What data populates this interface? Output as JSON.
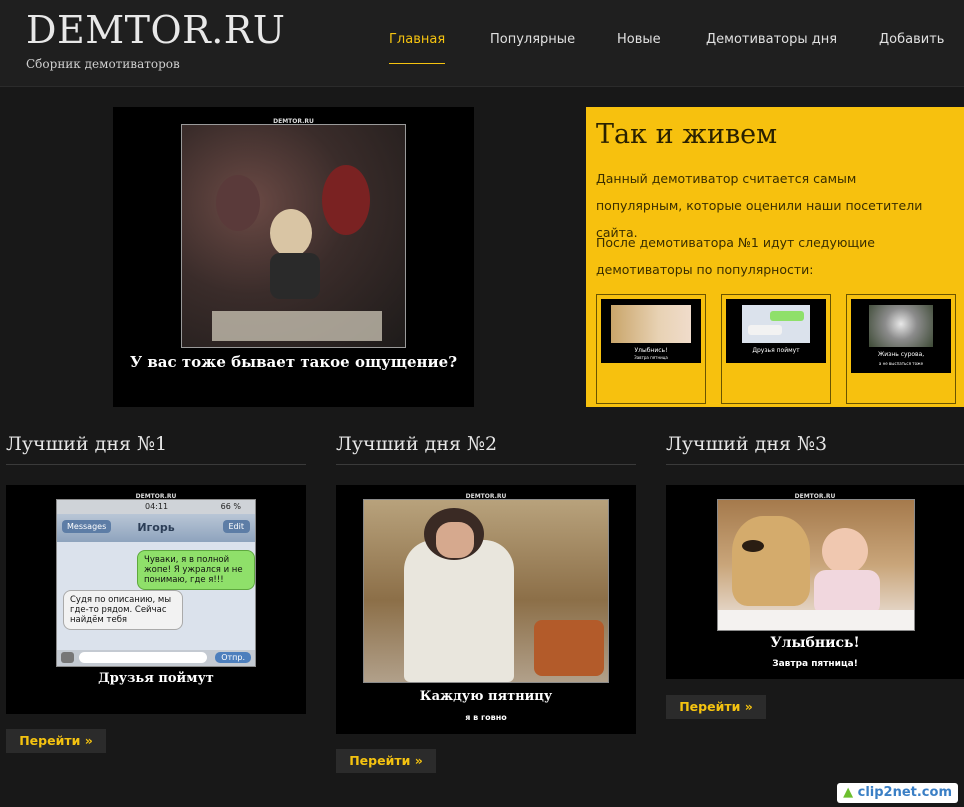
{
  "site": {
    "logo": "DEMTOR.RU",
    "tagline": "Сборник демотиваторов"
  },
  "nav": {
    "items": [
      {
        "label": "Главная",
        "active": true
      },
      {
        "label": "Популярные"
      },
      {
        "label": "Новые"
      },
      {
        "label": "Демотиваторы дня"
      },
      {
        "label": "Добавить"
      }
    ]
  },
  "hero": {
    "watermark": "DEMTOR.RU",
    "caption": "У вас тоже бывает такое ощущение?"
  },
  "popular": {
    "title": "Так и живем",
    "text1": "Данный демотиватор считается самым популярным, которые оценили наши посетители сайта.",
    "text2": "После демотиватора №1 идут следующие демотиваторы по популярности:",
    "thumbs": [
      {
        "caption": "Улыбнись!",
        "sub": "Завтра пятница"
      },
      {
        "caption": "Друзья поймут"
      },
      {
        "caption": "Жизнь сурова,",
        "sub": "а не выспаться тоже"
      }
    ]
  },
  "best": [
    {
      "title": "Лучший дня №1",
      "watermark": "DEMTOR.RU",
      "caption": "Друзья поймут",
      "button": "Перейти »",
      "phone": {
        "time": "04:11",
        "battery": "66 %",
        "back": "Messages",
        "contact": "Игорь",
        "edit": "Edit",
        "msg_out": "Чуваки, я в полной жопе! Я ужрался и не понимаю, где я!!!",
        "msg_in": "Судя по описанию, мы где-то рядом. Сейчас найдём тебя",
        "send": "Отпр."
      }
    },
    {
      "title": "Лучший дня №2",
      "watermark": "DEMTOR.RU",
      "caption": "Каждую пятницу",
      "sub": "я в говно",
      "button": "Перейти »"
    },
    {
      "title": "Лучший дня №3",
      "watermark": "DEMTOR.RU",
      "caption": "Улыбнись!",
      "sub": "Завтра пятница!",
      "button": "Перейти »"
    }
  ],
  "watermark_site": "clip2net.com",
  "colors": {
    "accent": "#f5c310",
    "background": "#181818",
    "panel": "#f7c10e"
  }
}
